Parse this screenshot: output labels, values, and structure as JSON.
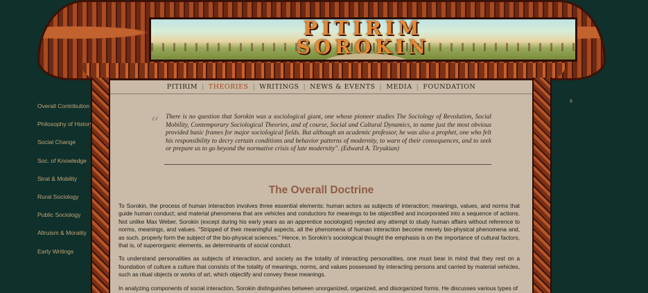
{
  "site_title": {
    "line1": "PITIRIM",
    "line2": "SOROKIN"
  },
  "top_nav": [
    {
      "label": "PITIRIM"
    },
    {
      "label": "THEORIES"
    },
    {
      "label": "WRITINGS"
    },
    {
      "label": "NEWS & EVENTS"
    },
    {
      "label": "MEDIA"
    },
    {
      "label": "FOUNDATION"
    }
  ],
  "active_top_nav": "THEORIES",
  "left_nav": [
    {
      "label": "Overall Contribution"
    },
    {
      "label": "Philosophy of History"
    },
    {
      "label": "Social Change"
    },
    {
      "label": "Soc. of Knowledge"
    },
    {
      "label": "Strat & Mobility"
    },
    {
      "label": "Rural Sociology"
    },
    {
      "label": "Public Sociology"
    },
    {
      "label": "Altruism & Morality"
    },
    {
      "label": "Early Writings"
    }
  ],
  "right_stray_text": "s",
  "quote": {
    "mark": "“",
    "text": "There is no question that Sorokin was a sociological giant, one whose pioneer studies The Sociology of Revolution, Social Mobility, Contemporary Sociological Theories, and of course, Social and Cultural Dynamics, to name just the most obvious provided basic frames for major sociological fields. But although an academic professor, he was also a prophet, one who felt his responsibility to decry certain conditions and behavior patterns of modernity, to warn of their consequences, and to seek or prepare us to go beyond the normative crisis of late modernity\". (Edward A. Tiryakian)"
  },
  "heading": "The Overall Doctrine",
  "paragraphs": [
    "To Sorokin, the process of human interaction involves three essential elements: human actors as subjects of interaction; meanings, values, and norms that guide human conduct; and material phenomena that are vehicles and conductors for meanings to be objectified and incorporated into a sequence of actions. Not unlike Max Weber, Sorokin (except during his early years as an apprentice sociologist) rejected any attempt to study human affairs without reference to norms, meanings, and values. \"Stripped of their meaningful aspects, all the phenomena of human interaction become merely bio-physical phenomena and, as such, properly form the subject of the bio-physical sciences.\" Hence, in Sorokin's sociological thought the emphasis is on the importance of cultural factors, that is, of superorganic elements, as determinants of social conduct.",
    "To understand personalities as subjects of interaction, and society as the totality of interacting personalities, one must bear in mind that they rest on a foundation of culture a culture that consists of the totality of meanings, norms, and values possessed by interacting persons and carried by material vehicles, such as ritual objects or works of art, which objectify and convey these meanings.",
    "In analyzing components of social interaction, Sorokin distinguishes between unorganized, organized, and disorganized forms. He discusses various types of"
  ],
  "colors": {
    "background": "#0f302b",
    "panel": "#c9bba8",
    "nav_text": "#c5a57a",
    "active_nav": "#a5441d",
    "heading": "#8f5c46"
  }
}
